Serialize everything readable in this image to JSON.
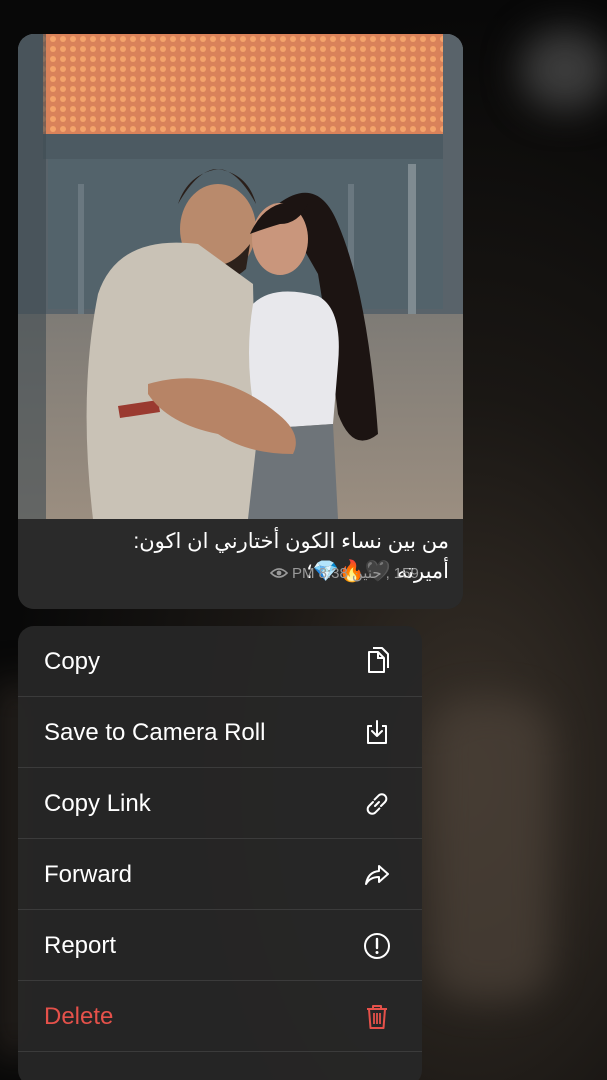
{
  "message": {
    "caption_line1": "من بين نساء الكون أختارني ان اكون:",
    "caption_line2": "أميرته 🖤🔥💎؛",
    "view_count": "159",
    "time": "PM 8:38",
    "author": "حنين",
    "meta_separator": ","
  },
  "menu": {
    "items": [
      {
        "label": "Copy",
        "icon": "copy-icon"
      },
      {
        "label": "Save to Camera Roll",
        "icon": "download-icon"
      },
      {
        "label": "Copy Link",
        "icon": "link-icon"
      },
      {
        "label": "Forward",
        "icon": "forward-icon"
      },
      {
        "label": "Report",
        "icon": "report-icon"
      },
      {
        "label": "Delete",
        "icon": "trash-icon"
      }
    ]
  },
  "colors": {
    "menu_background": "#262626",
    "delete_red": "#e5514a",
    "meta_gray": "#9a9a9a"
  }
}
